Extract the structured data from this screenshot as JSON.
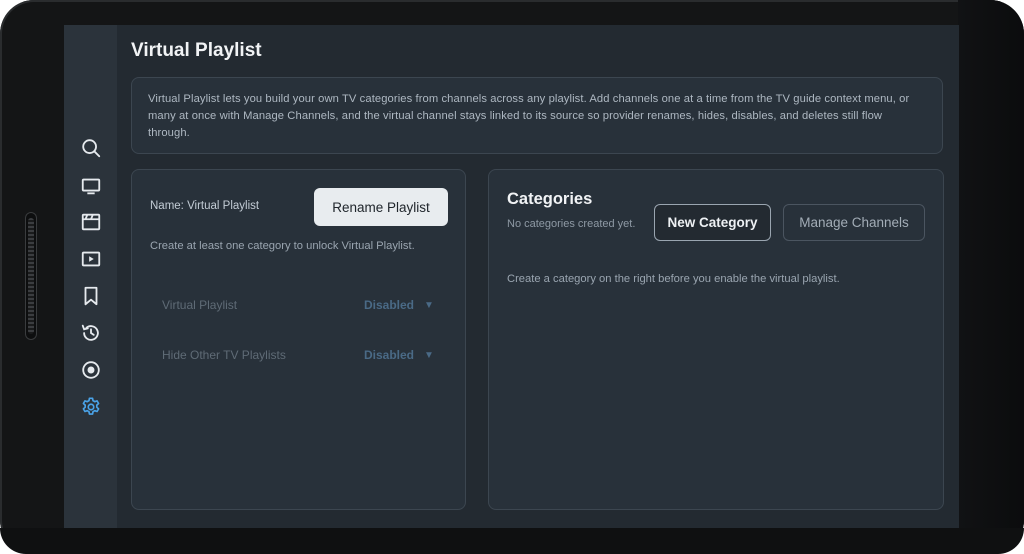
{
  "page": {
    "title": "Virtual Playlist",
    "description": "Virtual Playlist lets you build your own TV categories from channels across any playlist. Add channels one at a time from the TV guide context menu, or many at once with Manage Channels, and the virtual channel stays linked to its source so provider renames, hides, disables, and deletes still flow through."
  },
  "sidebar": {
    "items": [
      {
        "icon": "search-icon"
      },
      {
        "icon": "tv-icon"
      },
      {
        "icon": "movie-icon"
      },
      {
        "icon": "video-play-icon"
      },
      {
        "icon": "bookmark-icon"
      },
      {
        "icon": "history-icon"
      },
      {
        "icon": "record-icon"
      },
      {
        "icon": "settings-gear-icon",
        "active": true
      }
    ],
    "active_color": "#4aa3e8",
    "icon_color": "#e6eaee"
  },
  "left_panel": {
    "name_label": "Name: Virtual Playlist",
    "rename_button": "Rename Playlist",
    "hint": "Create at least one category to unlock Virtual Playlist.",
    "settings": [
      {
        "label": "Virtual Playlist",
        "value": "Disabled",
        "caret": "▼"
      },
      {
        "label": "Hide Other TV Playlists",
        "value": "Disabled",
        "caret": "▼"
      }
    ]
  },
  "right_panel": {
    "title": "Categories",
    "empty_text": "No categories created yet.",
    "new_category_button": "New Category",
    "manage_channels_button": "Manage Channels",
    "hint": "Create a category on the right before you enable the virtual playlist."
  }
}
